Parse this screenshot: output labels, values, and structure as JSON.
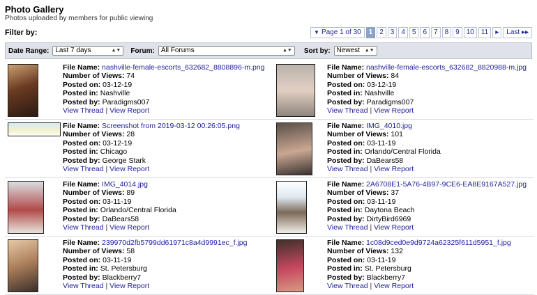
{
  "header": {
    "title": "Photo Gallery",
    "subtitle": "Photos uploaded by members for public viewing",
    "filter_label": "Filter by:"
  },
  "pager": {
    "page_of": "Page 1 of 30",
    "pages": [
      "1",
      "2",
      "3",
      "4",
      "5",
      "6",
      "7",
      "8",
      "9",
      "10",
      "11"
    ],
    "current": "1",
    "next_symbol": "▸",
    "last": "Last"
  },
  "filters": {
    "date_range_label": "Date Range:",
    "date_range_value": "Last 7 days",
    "forum_label": "Forum:",
    "forum_value": "All Forums",
    "sort_label": "Sort by:",
    "sort_value": "Newest"
  },
  "labels": {
    "file_name": "File Name:",
    "views": "Number of Views:",
    "posted_on": "Posted on:",
    "posted_in": "Posted in:",
    "posted_by": "Posted by:",
    "view_thread": "View Thread",
    "view_report": "View Report"
  },
  "photos": [
    {
      "file": "nashville-female-escorts_632682_8808896-m.png",
      "views": "74",
      "date": "03-12-19",
      "forum": "Nashville",
      "user": "Paradigms007"
    },
    {
      "file": "nashville-female-escorts_632682_8820988-m.jpg",
      "views": "84",
      "date": "03-12-19",
      "forum": "Nashville",
      "user": "Paradigms007"
    },
    {
      "file": "Screenshot from 2019-03-12 00:26:05.png",
      "views": "28",
      "date": "03-12-19",
      "forum": "Chicago",
      "user": "George Stark"
    },
    {
      "file": "IMG_4010.jpg",
      "views": "101",
      "date": "03-11-19",
      "forum": "Orlando/Central Florida",
      "user": "DaBears58"
    },
    {
      "file": "IMG_4014.jpg",
      "views": "89",
      "date": "03-11-19",
      "forum": "Orlando/Central Florida",
      "user": "DaBears58"
    },
    {
      "file": "2A6708E1-5A76-4B97-9CE6-EA8E9167A527.jpg",
      "views": "37",
      "date": "03-11-19",
      "forum": "Daytona Beach",
      "user": "DirtyBird6969"
    },
    {
      "file": "239970d2fb5799dd61971c8a4d9991ec_f.jpg",
      "views": "58",
      "date": "03-11-19",
      "forum": "St. Petersburg",
      "user": "Blackberry7"
    },
    {
      "file": "1c08d9ced0e9d9724a62325f611d5951_f.jpg",
      "views": "132",
      "date": "03-11-19",
      "forum": "St. Petersburg",
      "user": "Blackberry7"
    }
  ],
  "colors": {
    "link": "#22229c",
    "filter_bar": "#dfe3e9",
    "pager_current": "#8aa3c6"
  }
}
